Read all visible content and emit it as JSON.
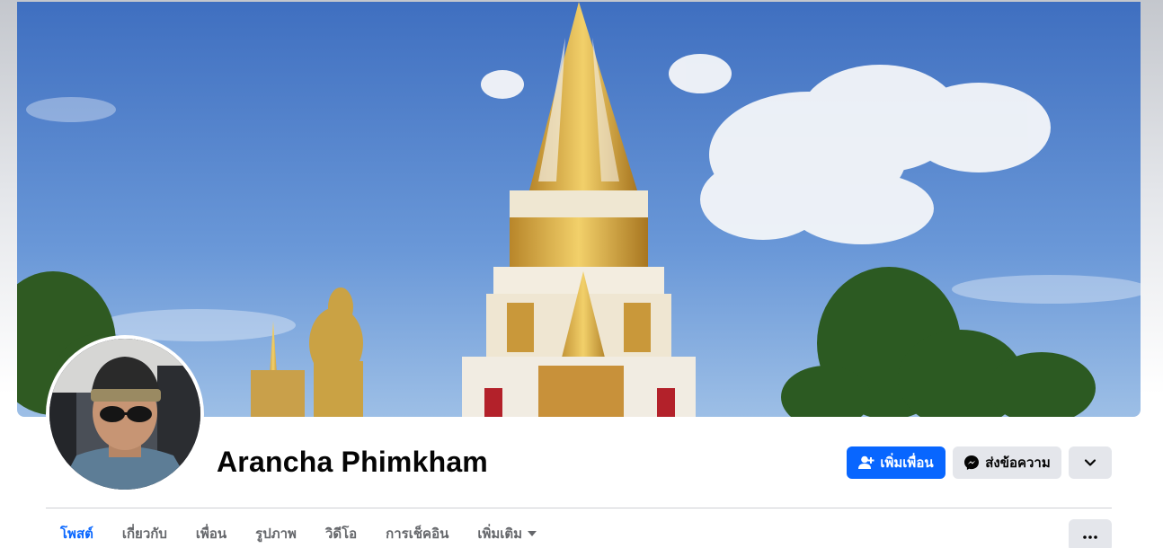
{
  "profile": {
    "name": "Arancha Phimkham"
  },
  "actions": {
    "add_friend_label": "เพิ่มเพื่อน",
    "message_label": "ส่งข้อความ"
  },
  "tabs": [
    {
      "label": "โพสต์",
      "active": true
    },
    {
      "label": "เกี่ยวกับ",
      "active": false
    },
    {
      "label": "เพื่อน",
      "active": false
    },
    {
      "label": "รูปภาพ",
      "active": false
    },
    {
      "label": "วิดีโอ",
      "active": false
    },
    {
      "label": "การเช็คอิน",
      "active": false
    },
    {
      "label": "เพิ่มเติม",
      "active": false
    }
  ],
  "icons": {
    "add_friend": "add-friend-icon",
    "messenger": "messenger-icon",
    "chevron": "chevron-down-icon",
    "caret": "caret-down-icon",
    "more": "more-dots-icon"
  },
  "colors": {
    "accent": "#0866ff",
    "secondary_button": "#e4e6eb",
    "text_primary": "#050505",
    "text_secondary": "#65676b"
  }
}
